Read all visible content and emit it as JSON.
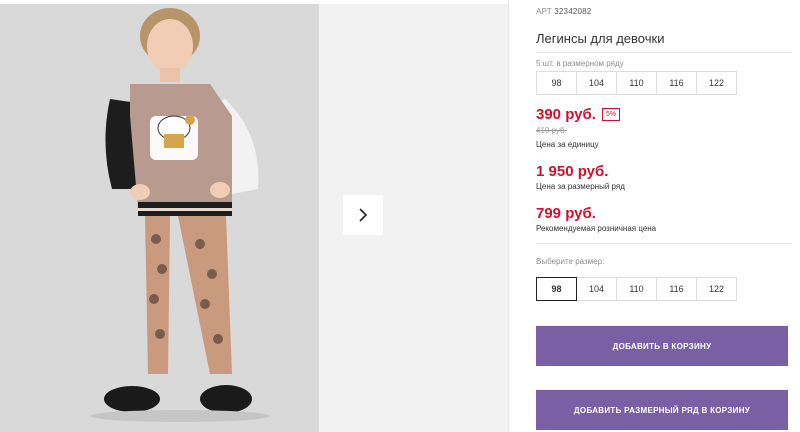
{
  "product": {
    "article_label": "АРТ",
    "article_number": "32342082",
    "title": "Легинсы для девочки"
  },
  "size_row": {
    "label": "5 шт. в размерном ряду",
    "sizes": [
      "98",
      "104",
      "110",
      "116",
      "122"
    ]
  },
  "prices": {
    "unit_price": "390 руб.",
    "discount_badge": "5%",
    "old_price": "410 руб.",
    "unit_note": "Цена за единицу",
    "row_price": "1 950 руб.",
    "row_note": "Цена за размерный ряд",
    "rrp_price": "799 руб.",
    "rrp_note": "Рекомендуемая розничная цена"
  },
  "size_picker": {
    "label": "Выберите размер:",
    "sizes": [
      "98",
      "104",
      "110",
      "116",
      "122"
    ],
    "selected": "98"
  },
  "actions": {
    "add_to_cart": "ДОБАВИТЬ В КОРЗИНУ",
    "add_row_to_cart": "ДОБАВИТЬ РАЗМЕРНЫЙ РЯД В КОРЗИНУ"
  },
  "gallery": {
    "next_icon": "chevron-right-icon"
  },
  "colors": {
    "accent": "#7a5fa5",
    "price": "#d0102d"
  }
}
